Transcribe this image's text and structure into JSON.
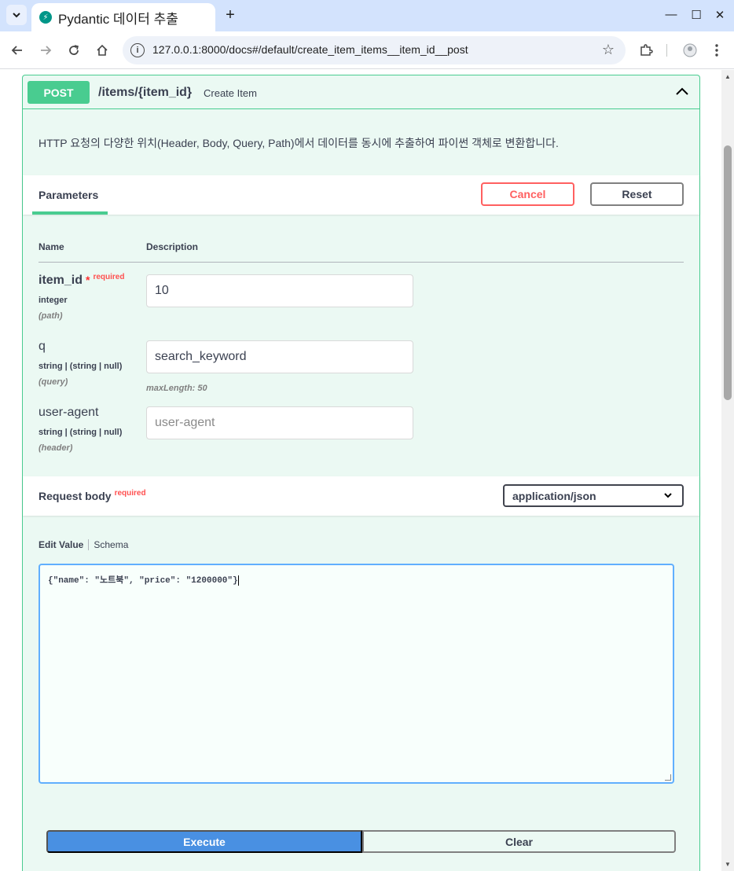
{
  "browser": {
    "tab_title": "Pydantic 데이터 추출",
    "favicon": "⚡",
    "new_tab": "+",
    "url": "127.0.0.1:8000/docs#/default/create_item_items__item_id__post",
    "minimize": "—",
    "maximize": "☐",
    "close": "✕"
  },
  "operation": {
    "method": "POST",
    "path": "/items/{item_id}",
    "summary": "Create Item",
    "description": "HTTP 요청의 다양한 위치(Header, Body, Query, Path)에서 데이터를 동시에 추출하여 파이썬 객체로 변환합니다."
  },
  "parameters": {
    "tab_label": "Parameters",
    "cancel_label": "Cancel",
    "reset_label": "Reset",
    "col_name": "Name",
    "col_description": "Description",
    "items": [
      {
        "name": "item_id",
        "required_star": "*",
        "required_label": "required",
        "type": "integer",
        "in": "(path)",
        "value": "10"
      },
      {
        "name": "q",
        "type": "string | (string | null)",
        "in": "(query)",
        "value": "search_keyword",
        "constraint": "maxLength: 50"
      },
      {
        "name": "user-agent",
        "type": "string | (string | null)",
        "in": "(header)",
        "placeholder": "user-agent"
      }
    ]
  },
  "request_body": {
    "title": "Request body",
    "required_label": "required",
    "content_type": "application/json",
    "tab_edit": "Edit Value",
    "tab_schema": "Schema",
    "value": "{\"name\": \"노트북\", \"price\": \"1200000\"}"
  },
  "actions": {
    "execute_label": "Execute",
    "clear_label": "Clear"
  },
  "colors": {
    "post": "#49cc90",
    "post_bg": "#ebf9f3",
    "execute": "#4990e2",
    "cancel": "#ff6060",
    "tab_bar": "#d3e3fd"
  }
}
